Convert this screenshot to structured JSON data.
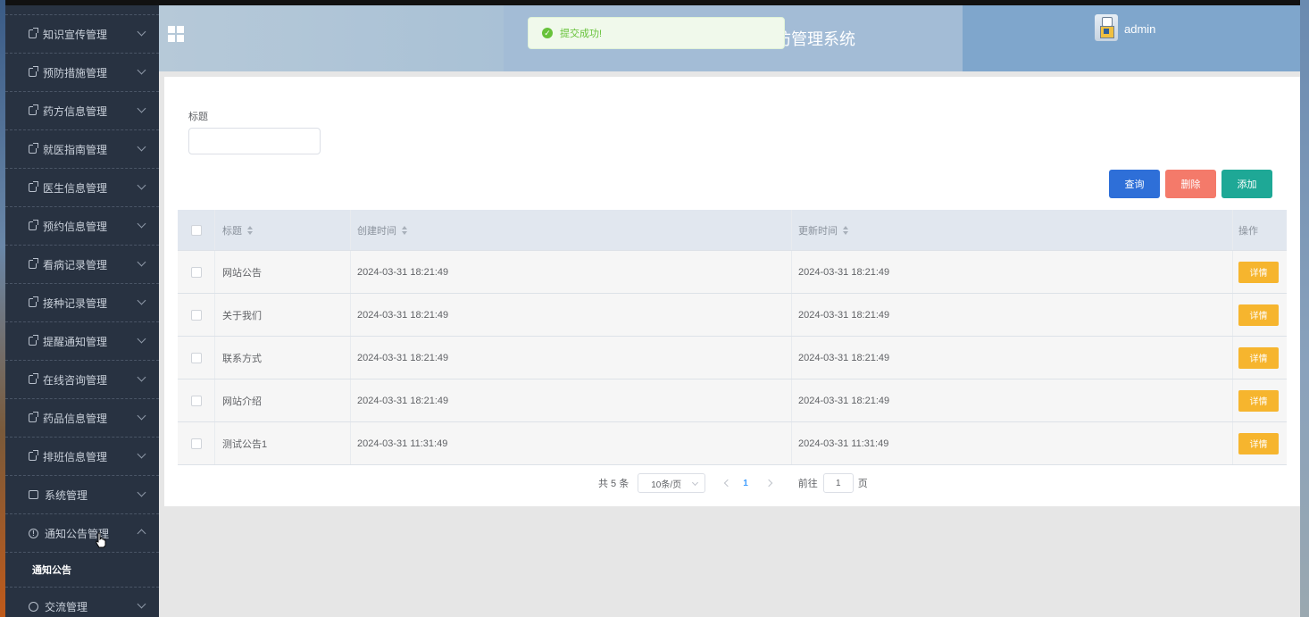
{
  "header": {
    "title": "防管理系统",
    "username": "admin"
  },
  "toast": {
    "message": "提交成功!"
  },
  "sidebar": {
    "items": [
      {
        "label": "知识宣传管理",
        "icon": "document-icon"
      },
      {
        "label": "预防措施管理",
        "icon": "document-icon"
      },
      {
        "label": "药方信息管理",
        "icon": "document-icon"
      },
      {
        "label": "就医指南管理",
        "icon": "document-icon"
      },
      {
        "label": "医生信息管理",
        "icon": "document-icon"
      },
      {
        "label": "预约信息管理",
        "icon": "document-icon"
      },
      {
        "label": "看病记录管理",
        "icon": "document-icon"
      },
      {
        "label": "接种记录管理",
        "icon": "document-icon"
      },
      {
        "label": "提醒通知管理",
        "icon": "document-icon"
      },
      {
        "label": "在线咨询管理",
        "icon": "document-icon"
      },
      {
        "label": "药品信息管理",
        "icon": "document-icon"
      },
      {
        "label": "排班信息管理",
        "icon": "document-icon"
      },
      {
        "label": "系统管理",
        "icon": "picture-icon"
      },
      {
        "label": "通知公告管理",
        "icon": "info-icon"
      },
      {
        "label": "交流管理",
        "icon": "chat-icon"
      }
    ],
    "submenu": {
      "label": "通知公告"
    }
  },
  "search": {
    "label": "标题",
    "value": ""
  },
  "buttons": {
    "query": "查询",
    "delete": "删除",
    "add": "添加"
  },
  "table": {
    "headers": {
      "title": "标题",
      "created": "创建时间",
      "updated": "更新时间",
      "ops": "操作"
    },
    "detail_label": "详情",
    "rows": [
      {
        "title": "网站公告",
        "created": "2024-03-31 18:21:49",
        "updated": "2024-03-31 18:21:49"
      },
      {
        "title": "关于我们",
        "created": "2024-03-31 18:21:49",
        "updated": "2024-03-31 18:21:49"
      },
      {
        "title": "联系方式",
        "created": "2024-03-31 18:21:49",
        "updated": "2024-03-31 18:21:49"
      },
      {
        "title": "网站介绍",
        "created": "2024-03-31 18:21:49",
        "updated": "2024-03-31 18:21:49"
      },
      {
        "title": "测试公告1",
        "created": "2024-03-31 11:31:49",
        "updated": "2024-03-31 11:31:49"
      }
    ]
  },
  "pagination": {
    "total": "共 5 条",
    "page_size": "10条/页",
    "current": "1",
    "goto_label": "前往",
    "goto_value": "1",
    "goto_suffix": "页"
  },
  "colors": {
    "sidebar_bg": "#283241",
    "query": "#2e6fd8",
    "delete": "#f47a6a",
    "add": "#1ea896",
    "detail": "#f6b52e",
    "success": "#67c23a"
  }
}
